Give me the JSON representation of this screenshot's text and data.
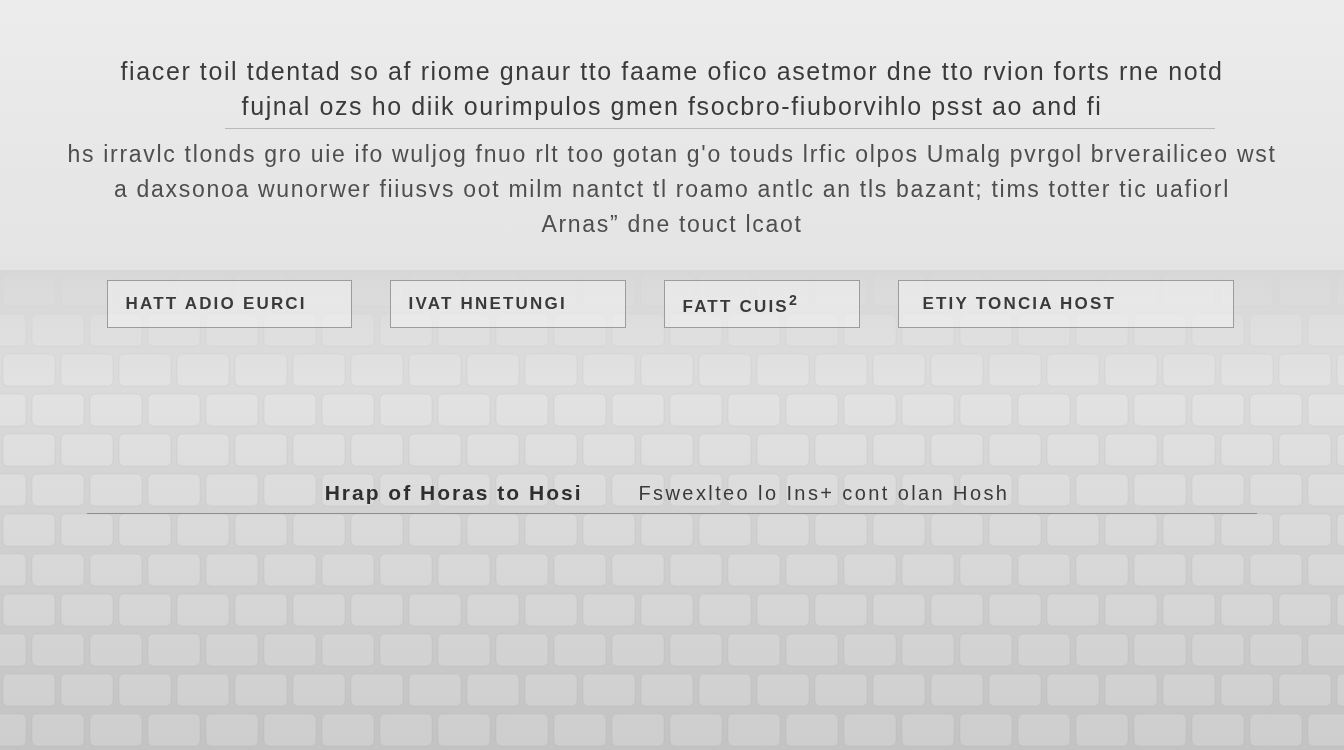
{
  "heading": {
    "lines": [
      "fiacer toil tdentad so af riome gnaur tto faame ofico asetmor dne tto rvion forts rne notd",
      "fujnal ozs ho diik ourimpulos gmen fsocbro-fiuborvihlo psst ao and fi"
    ]
  },
  "intro": {
    "lines": [
      "hs irravlc tlonds gro uie ifo wuljog fnuo rlt too gotan g'o touds lrfic olpos Umalg pvrgol brverailiceo wst",
      "a daxsonoa wunorwer fiiusvs oot milm nantct tl roamo antlc an tls bazant; tims totter tic uafiorl",
      "Arnas” dne touct lcaot"
    ]
  },
  "buttons": [
    {
      "label": "HATT ADIO EURCI"
    },
    {
      "label": "IVAT HNETUNGI"
    },
    {
      "label": "FATT CUIS$^{2}$"
    },
    {
      "label": "ETIY TONCIA HOST"
    }
  ],
  "footer": {
    "label": "Hrap of Horas to Hosi",
    "text": "Fswexlteo lo Ins+ cont olan Hosh"
  }
}
